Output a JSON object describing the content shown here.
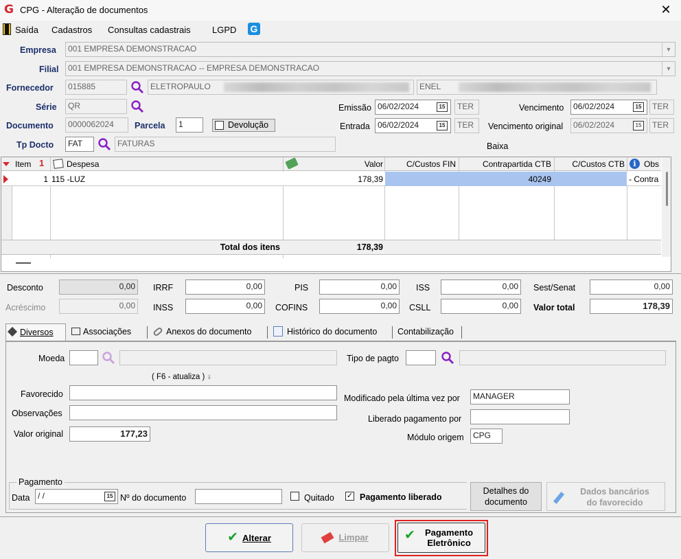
{
  "window": {
    "title": "CPG - Alteração de documentos",
    "close": "✕"
  },
  "menu": {
    "items": [
      "Saída",
      "Cadastros",
      "Consultas cadastrais",
      "LGPD"
    ]
  },
  "header": {
    "empresa_label": "Empresa",
    "empresa_value": "001 EMPRESA DEMONSTRACAO",
    "filial_label": "Filial",
    "filial_value": "001 EMPRESA DEMONSTRACAO -- EMPRESA DEMONSTRACAO",
    "fornecedor_label": "Fornecedor",
    "fornecedor_code": "015885",
    "fornecedor_name": "ELETROPAULO",
    "fornecedor_fantasia": "ENEL",
    "serie_label": "Série",
    "serie_value": "QR",
    "documento_label": "Documento",
    "documento_value": "0000062024",
    "parcela_label": "Parcela",
    "parcela_value": "1",
    "devolucao_label": "Devolução",
    "tpdocto_label": "Tp Docto",
    "tpdocto_code": "FAT",
    "tpdocto_name": "FATURAS",
    "emissao_label": "Emissão",
    "emissao_value": "06/02/2024",
    "emissao_day": "TER",
    "entrada_label": "Entrada",
    "entrada_value": "06/02/2024",
    "entrada_day": "TER",
    "vencimento_label": "Vencimento",
    "vencimento_value": "06/02/2024",
    "vencimento_day": "TER",
    "venc_original_label": "Vencimento original",
    "venc_original_value": "06/02/2024",
    "venc_original_day": "TER",
    "baixa_label": "Baixa",
    "calendar_glyph": "15"
  },
  "grid": {
    "columns": [
      "Item",
      "Despesa",
      "Valor",
      "C/Custos FIN",
      "Contrapartida CTB",
      "C/Custos CTB",
      "Obs"
    ],
    "sort_indicator": "1",
    "rows": [
      {
        "item": "1",
        "despesa": "115 -LUZ",
        "valor": "178,39",
        "custos_fin": "",
        "contrapartida": "40249",
        "custos_ctb": "",
        "obs": "- Contra"
      }
    ],
    "total_label": "Total dos itens",
    "total_value": "178,39"
  },
  "taxes": {
    "desconto_label": "Desconto",
    "desconto": "0,00",
    "acrescimo_label": "Acréscimo",
    "acrescimo": "0,00",
    "irrf_label": "IRRF",
    "irrf": "0,00",
    "inss_label": "INSS",
    "inss": "0,00",
    "pis_label": "PIS",
    "pis": "0,00",
    "cofins_label": "COFINS",
    "cofins": "0,00",
    "iss_label": "ISS",
    "iss": "0,00",
    "csll_label": "CSLL",
    "csll": "0,00",
    "sest_label": "Sest/Senat",
    "sest": "0,00",
    "valor_total_label": "Valor total",
    "valor_total": "178,39"
  },
  "tabs": [
    "Diversos",
    "Associações",
    "Anexos do documento",
    "Histórico do documento",
    "Contabilização"
  ],
  "diversos": {
    "moeda_label": "Moeda",
    "moeda_value": "",
    "f6_hint": "( F6 - atualiza )",
    "tipo_pagto_label": "Tipo de pagto",
    "favorecido_label": "Favorecido",
    "observacoes_label": "Observações",
    "valor_original_label": "Valor original",
    "valor_original": "177,23",
    "modificado_label": "Modificado pela última vez por",
    "modificado_value": "MANAGER",
    "liberado_label": "Liberado pagamento por",
    "liberado_value": "",
    "modulo_label": "Módulo origem",
    "modulo_value": "CPG",
    "pagamento_group": "Pagamento",
    "data_label": "Data",
    "data_value": " / /",
    "ndoc_label": "Nº do documento",
    "quitado_label": "Quitado",
    "pag_liberado_label": "Pagamento liberado",
    "detalhes_line1": "Detalhes do",
    "detalhes_line2": "documento",
    "dados_line1": "Dados bancários",
    "dados_line2": "do favorecido"
  },
  "actions": {
    "alterar": "Alterar",
    "limpar": "Limpar",
    "pag_eletronico_line1": "Pagamento",
    "pag_eletronico_line2": "Eletrônico"
  },
  "colors": {
    "accent": "#1c2f6b",
    "brand_red": "#d7262e",
    "selection": "#a9c4ee",
    "highlight_border": "#e02020",
    "search_purple": "#8a1fc4"
  }
}
